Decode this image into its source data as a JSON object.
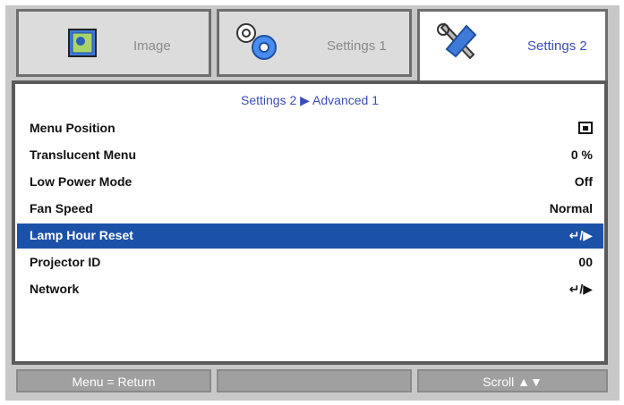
{
  "tabs": [
    {
      "label": "Image",
      "icon": "image-icon",
      "active": false
    },
    {
      "label": "Settings 1",
      "icon": "gears-icon",
      "active": false
    },
    {
      "label": "Settings 2",
      "icon": "tools-icon",
      "active": true
    }
  ],
  "breadcrumb": "Settings 2 ▶ Advanced 1",
  "menu": [
    {
      "name": "Menu Position",
      "value": "",
      "value_icon": "menu-position-icon",
      "selected": false
    },
    {
      "name": "Translucent Menu",
      "value": "0 %",
      "selected": false
    },
    {
      "name": "Low Power Mode",
      "value": "Off",
      "selected": false
    },
    {
      "name": "Fan Speed",
      "value": "Normal",
      "selected": false
    },
    {
      "name": "Lamp Hour Reset",
      "value": "↵/▶",
      "selected": true
    },
    {
      "name": "Projector ID",
      "value": "00",
      "selected": false
    },
    {
      "name": "Network",
      "value": "↵/▶",
      "selected": false
    }
  ],
  "footer": {
    "left": "Menu = Return",
    "middle": "",
    "right": "Scroll ▲▼"
  },
  "colors": {
    "accent": "#3a4db8",
    "selection": "#1c51a8"
  }
}
